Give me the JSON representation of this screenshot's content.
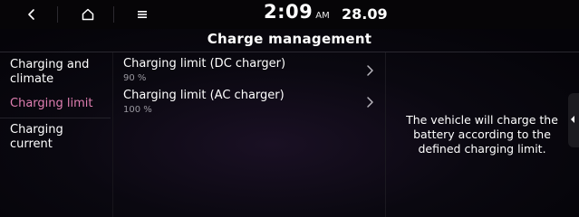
{
  "status_bar": {
    "time": "2:09",
    "ampm": "AM",
    "date": "28.09",
    "icons": {
      "back": "back-arrow-icon",
      "home": "home-icon",
      "menu": "menu-icon"
    }
  },
  "page": {
    "title": "Charge management"
  },
  "sidebar": {
    "items": [
      {
        "label": "Charging and climate",
        "active": false
      },
      {
        "label": "Charging limit",
        "active": true
      },
      {
        "label": "Charging current",
        "active": false
      }
    ]
  },
  "list": {
    "items": [
      {
        "label": "Charging limit (DC charger)",
        "value": "90 %"
      },
      {
        "label": "Charging limit (AC charger)",
        "value": "100 %"
      }
    ]
  },
  "info": {
    "text": "The vehicle will charge the battery according to the defined charging limit."
  },
  "colors": {
    "active_accent": "#e07fb2",
    "secondary_text": "#9a98a0",
    "background": "#0a0810"
  }
}
